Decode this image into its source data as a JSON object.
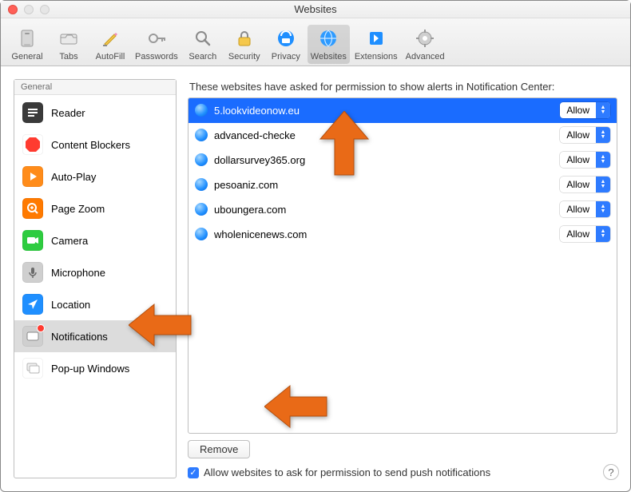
{
  "window": {
    "title": "Websites"
  },
  "toolbar": {
    "items": [
      {
        "id": "general",
        "label": "General"
      },
      {
        "id": "tabs",
        "label": "Tabs"
      },
      {
        "id": "autofill",
        "label": "AutoFill"
      },
      {
        "id": "passwords",
        "label": "Passwords"
      },
      {
        "id": "search",
        "label": "Search"
      },
      {
        "id": "security",
        "label": "Security"
      },
      {
        "id": "privacy",
        "label": "Privacy"
      },
      {
        "id": "websites",
        "label": "Websites"
      },
      {
        "id": "extensions",
        "label": "Extensions"
      },
      {
        "id": "advanced",
        "label": "Advanced"
      }
    ],
    "selected_id": "websites"
  },
  "sidebar": {
    "header": "General",
    "items": [
      {
        "label": "Reader",
        "icon": "reader-icon"
      },
      {
        "label": "Content Blockers",
        "icon": "stop-icon"
      },
      {
        "label": "Auto-Play",
        "icon": "play-icon"
      },
      {
        "label": "Page Zoom",
        "icon": "zoom-icon"
      },
      {
        "label": "Camera",
        "icon": "camera-icon"
      },
      {
        "label": "Microphone",
        "icon": "mic-icon"
      },
      {
        "label": "Location",
        "icon": "location-icon"
      },
      {
        "label": "Notifications",
        "icon": "bell-icon",
        "has_badge": true
      },
      {
        "label": "Pop-up Windows",
        "icon": "window-icon"
      }
    ],
    "selected_index": 7
  },
  "panel": {
    "description": "These websites have asked for permission to show alerts in Notification Center:",
    "sites": [
      {
        "domain": "5.lookvideonow.eu",
        "permission": "Allow",
        "selected": true
      },
      {
        "domain": "advanced-checke",
        "permission": "Allow",
        "selected": false
      },
      {
        "domain": "dollarsurvey365.org",
        "permission": "Allow",
        "selected": false
      },
      {
        "domain": "pesoaniz.com",
        "permission": "Allow",
        "selected": false
      },
      {
        "domain": "uboungera.com",
        "permission": "Allow",
        "selected": false
      },
      {
        "domain": "wholenicenews.com",
        "permission": "Allow",
        "selected": false
      }
    ],
    "remove_label": "Remove",
    "checkbox_label": "Allow websites to ask for permission to send push notifications",
    "checkbox_checked": true
  },
  "help_label": "?"
}
